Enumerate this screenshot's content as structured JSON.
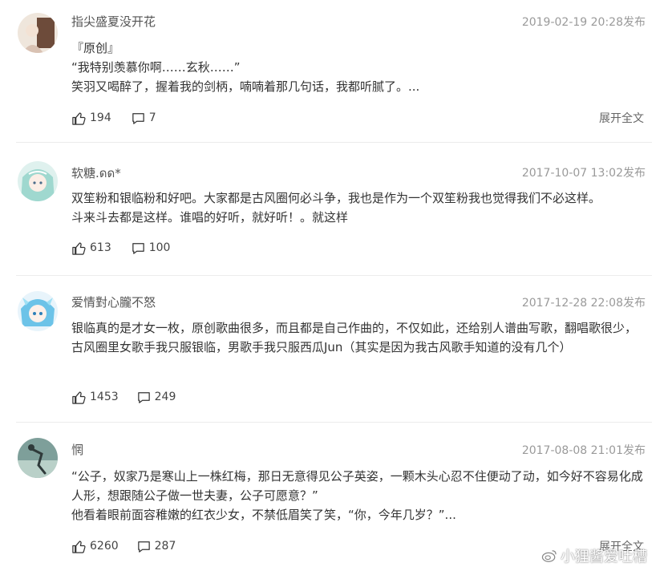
{
  "comments": [
    {
      "username": "指尖盛夏没开花",
      "timestamp": "2019-02-19 20:28发布",
      "lines": [
        "『原创』",
        "“我特别羡慕你啊……玄秋……”",
        "笑羽又喝醉了，握着我的剑柄，喃喃着那几句话，我都听腻了。..."
      ],
      "likes": "194",
      "replies": "7",
      "expand": "展开全文"
    },
    {
      "username": "软糖.ดด*",
      "timestamp": "2017-10-07 13:02发布",
      "lines": [
        "双笙粉和银临粉和好吧。大家都是古风圈何必斗争，我也是作为一个双笙粉我也觉得我们不必这样。",
        "斗来斗去都是这样。谁唱的好听，就好听！。就这样"
      ],
      "likes": "613",
      "replies": "100"
    },
    {
      "username": "爱情對心朧不怒",
      "timestamp": "2017-12-28 22:08发布",
      "lines": [
        "银临真的是才女一枚，原创歌曲很多，而且都是自己作曲的，不仅如此，还给别人谱曲写歌，翻唱歌很少，古风圈里女歌手我只服银临，男歌手我只服西瓜Jun（其实是因为我古风歌手知道的没有几个）"
      ],
      "likes": "1453",
      "replies": "249"
    },
    {
      "username": "惘",
      "timestamp": "2017-08-08 21:01发布",
      "lines": [
        "“公子，奴家乃是寒山上一株红梅，那日无意得见公子英姿，一颗木头心忍不住便动了动，如今好不容易化成人形，想跟随公子做一世夫妻，公子可愿意？”",
        "他看着眼前面容稚嫩的红衣少女，不禁低眉笑了笑，“你，今年几岁？”..."
      ],
      "likes": "6260",
      "replies": "287",
      "expand": "展开全文"
    }
  ],
  "watermark": "小狸酱爱吐槽",
  "icons": {
    "like": "thumbs-up-icon",
    "reply": "speech-bubble-icon",
    "weibo": "weibo-logo-icon"
  }
}
